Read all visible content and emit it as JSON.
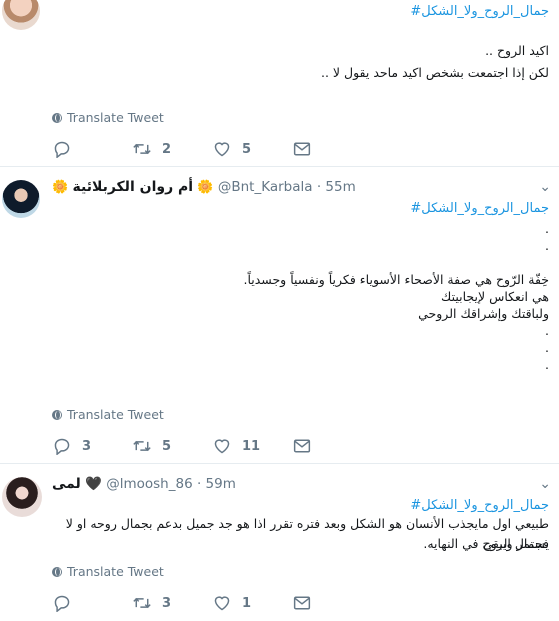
{
  "ui": {
    "translate_label": "Translate Tweet"
  },
  "tweets": [
    {
      "display_name": "",
      "handle": "",
      "time": "",
      "hashtag": "#جمال_الروح_ولا_الشكل",
      "lines": [
        "اكيد الروح ..",
        "لكن إذا اجتمعت بشخص اكيد ماحد يقول لا .."
      ],
      "reply_count": "",
      "retweet_count": "2",
      "like_count": "5"
    },
    {
      "display_name": "أم روان الكربلائية",
      "flower": "🌼",
      "handle": "@Bnt_Karbala",
      "time": "· 55m",
      "hashtag": "#جمال_الروح_ولا_الشكل",
      "lines": [
        ".",
        ".",
        "",
        "خِفّة الرّوح هي صفة الأصحاء الأسوياء فكرياً ونفسياً وجسدياً.",
        "هي انعكاس لإيجابيتك",
        "ولباقتك وإشراقك الروحي",
        ".",
        ".",
        "."
      ],
      "reply_count": "3",
      "retweet_count": "5",
      "like_count": "11"
    },
    {
      "display_name": "لمى",
      "heart": "🖤",
      "handle": "@lmoosh_86",
      "time": "· 59m",
      "hashtag": "#جمال_الروح_ولا_الشكل",
      "lines": [
        "طبيعي اول مايجذب الأنسان هو الشكل وبعد فتره تقرر اذا هو جد جميل بدعم بجمال روحه او لا فجمال الروح",
        "يستمر ويبقى في النهايه."
      ],
      "reply_count": "",
      "retweet_count": "3",
      "like_count": "1"
    }
  ]
}
